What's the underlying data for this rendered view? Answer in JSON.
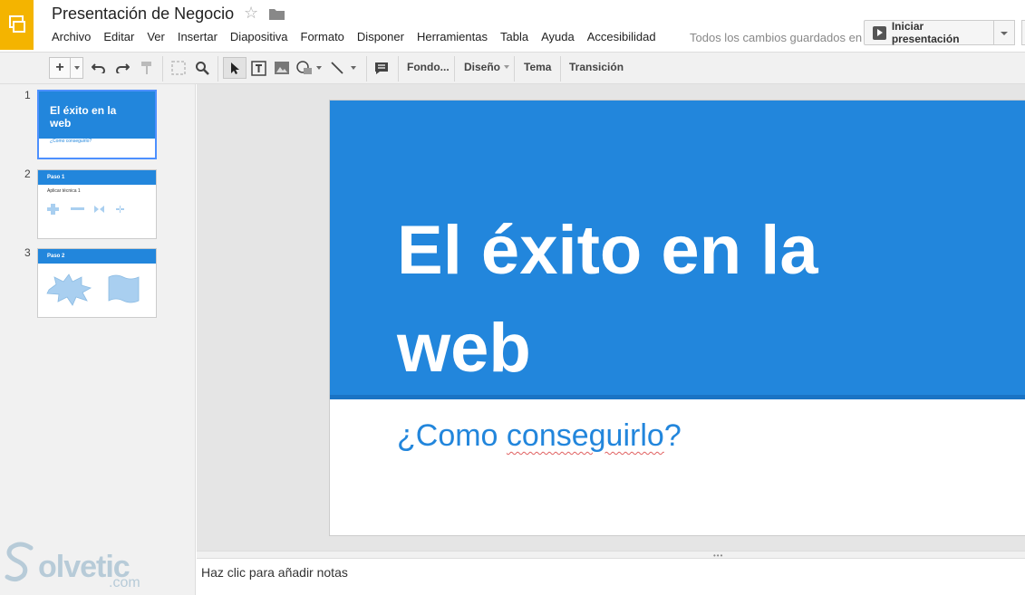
{
  "header": {
    "doc_title": "Presentación de Negocio",
    "star_icon": "star-icon",
    "folder_icon": "folder-icon",
    "save_status": "Todos los cambios guardados en",
    "present_label": "Iniciar presentación"
  },
  "menu": [
    "Archivo",
    "Editar",
    "Ver",
    "Insertar",
    "Diapositiva",
    "Formato",
    "Disponer",
    "Herramientas",
    "Tabla",
    "Ayuda",
    "Accesibilidad"
  ],
  "toolbar": {
    "new_slide": "+",
    "background": "Fondo...",
    "layout": "Diseño",
    "theme": "Tema",
    "transition": "Transición"
  },
  "slides": [
    {
      "number": "1",
      "title": "El éxito en la web",
      "subtitle": "¿Como conseguirlo?"
    },
    {
      "number": "2",
      "title": "Paso 1",
      "body": "Aplicar técnica 1"
    },
    {
      "number": "3",
      "title": "Paso 2"
    }
  ],
  "current_slide": {
    "title": "El éxito en la web",
    "subtitle_prefix": "¿Como ",
    "subtitle_misspelled": "conseguirlo",
    "subtitle_suffix": "?"
  },
  "notes": {
    "placeholder": "Haz clic para añadir notas"
  },
  "watermark": {
    "text": "olvetic",
    "suffix": ".com"
  },
  "colors": {
    "accent": "#2286dc",
    "logo": "#f4b400",
    "selection": "#4d90fe"
  }
}
